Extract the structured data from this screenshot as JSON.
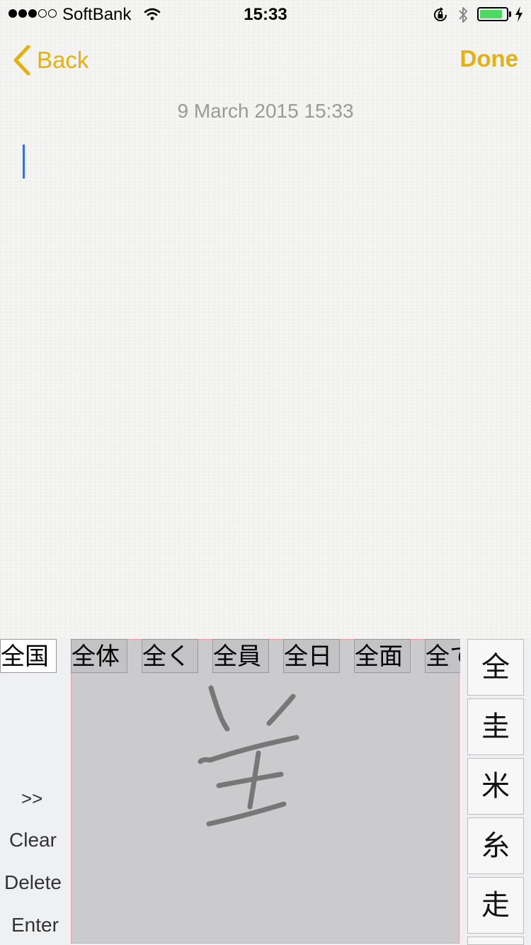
{
  "status_bar": {
    "carrier": "SoftBank",
    "time": "15:33",
    "signal_bars_filled": 3,
    "signal_bars_total": 5,
    "battery_level": 0.85,
    "battery_color": "#4cd964"
  },
  "nav": {
    "back_label": "Back",
    "done_label": "Done",
    "accent_color": "#e6b10c"
  },
  "note": {
    "date": "9 March 2015 15:33",
    "content": ""
  },
  "keyboard": {
    "candidates": [
      "全国",
      "全体",
      "全く",
      "全員",
      "全日",
      "全面",
      "全て"
    ],
    "more_label": ">>",
    "clear_label": "Clear",
    "delete_label": "Delete",
    "enter_label": "Enter",
    "char_candidates": [
      "全",
      "圭",
      "米",
      "糸",
      "走"
    ]
  }
}
